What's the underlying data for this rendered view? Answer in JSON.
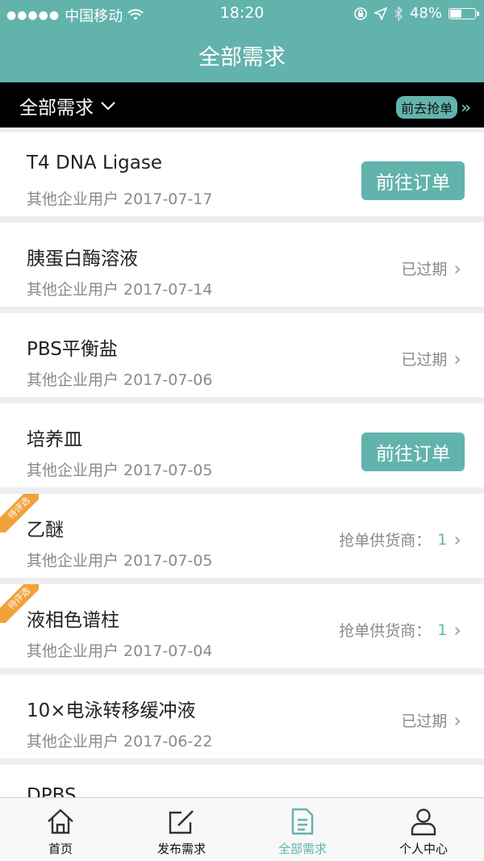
{
  "status_bar": {
    "carrier": "中国移动",
    "time": "18:20",
    "battery": "48%",
    "battery_level": 0.48
  },
  "nav": {
    "title": "全部需求"
  },
  "filter": {
    "dropdown_label": "全部需求",
    "grab_label": "前去抢单"
  },
  "items": [
    {
      "title": "T4 DNA Ligase",
      "subtitle": "其他企业用户 2017-07-17",
      "action": "前往订单"
    },
    {
      "title": "胰蛋白酶溶液",
      "subtitle": "其他企业用户 2017-07-14",
      "status": "已过期"
    },
    {
      "title": "PBS平衡盐",
      "subtitle": "其他企业用户 2017-07-06",
      "status": "已过期"
    },
    {
      "title": "培养皿",
      "subtitle": "其他企业用户 2017-07-05",
      "action": "前往订单"
    },
    {
      "title": "乙醚",
      "subtitle": "其他企业用户 2017-07-05",
      "status": "抢单供货商：",
      "count": "1",
      "ribbon": "待评选"
    },
    {
      "title": "液相色谱柱",
      "subtitle": "其他企业用户 2017-07-04",
      "status": "抢单供货商：",
      "count": "1",
      "ribbon": "待评选"
    },
    {
      "title": "10×电泳转移缓冲液",
      "subtitle": "其他企业用户 2017-06-22",
      "status": "已过期"
    },
    {
      "title": "DPBS"
    }
  ],
  "tabs": [
    {
      "label": "首页",
      "icon": "home-icon"
    },
    {
      "label": "发布需求",
      "icon": "edit-icon"
    },
    {
      "label": "全部需求",
      "icon": "document-icon",
      "active": true
    },
    {
      "label": "个人中心",
      "icon": "person-icon"
    }
  ],
  "colors": {
    "accent": "#63b3ad",
    "ribbon": "#f0a23a"
  }
}
